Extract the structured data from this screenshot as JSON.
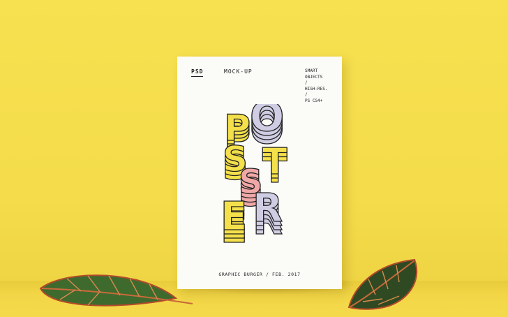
{
  "scene": {
    "wall_color": "#f5dd4f",
    "poster_color": "#fbfbf8"
  },
  "poster": {
    "brand": "PSD",
    "header": "MOCK-UP",
    "specs": [
      "SMART",
      "OBJECTS",
      "/",
      "HIGH-RES.",
      "/",
      "PS CS4+"
    ],
    "letters": {
      "p": "P",
      "o": "O",
      "s1": "S",
      "t": "T",
      "e": "E",
      "r": "R",
      "s2": "S",
      "accent_s": "S"
    },
    "colors": {
      "yellow": "#f4e04a",
      "lavender": "#cfcde3",
      "pink": "#f0a8a7",
      "ink": "#222222"
    },
    "footer": "GRAPHIC BURGER / FEB. 2017"
  },
  "decor": {
    "left_leaf": "leaf-icon",
    "right_leaf": "leaf-icon"
  }
}
